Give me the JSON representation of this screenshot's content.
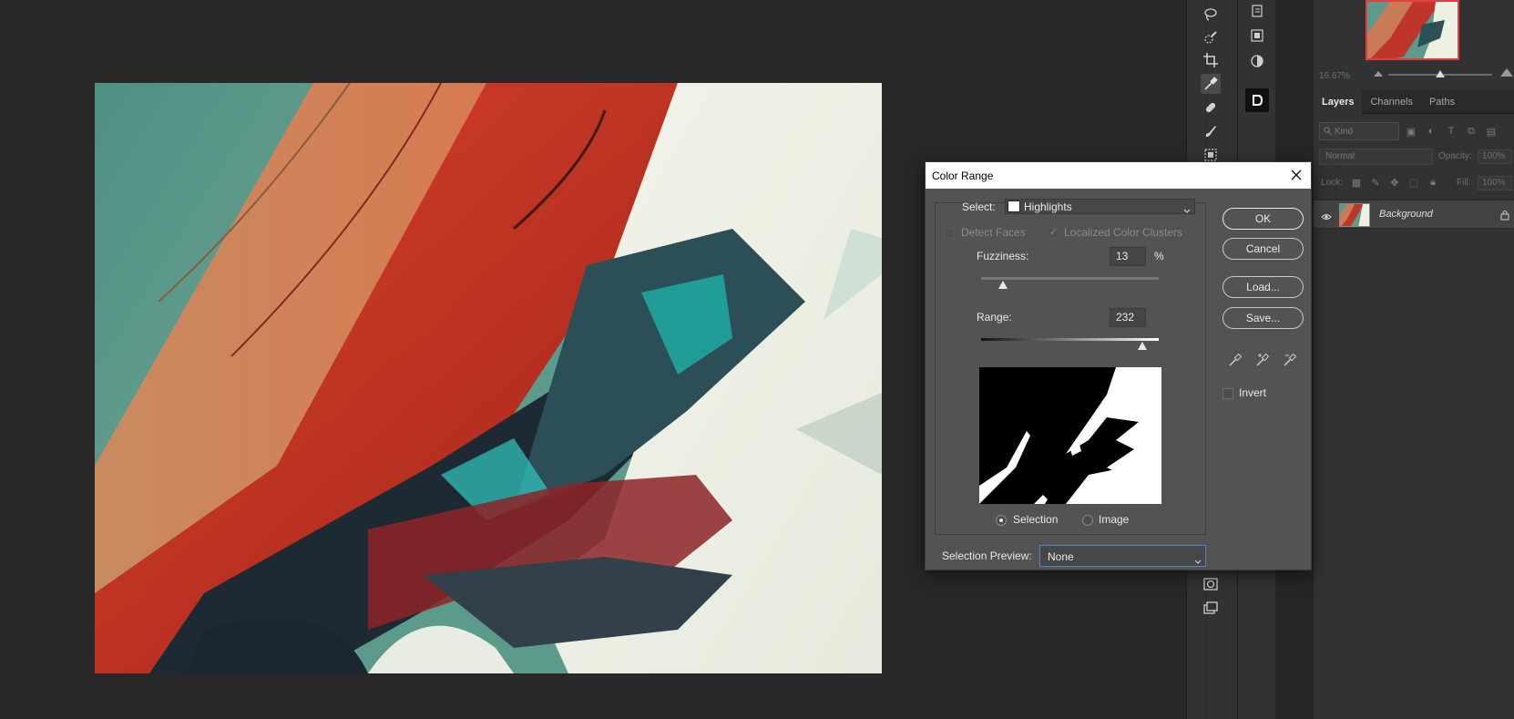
{
  "dialog": {
    "title": "Color Range",
    "select_label": "Select:",
    "select_value": "Highlights",
    "detect_faces_label": "Detect Faces",
    "localized_clusters_label": "Localized Color Clusters",
    "fuzziness_label": "Fuzziness:",
    "fuzziness_value": "13",
    "fuzziness_unit": "%",
    "fuzziness_level_pct": 13,
    "range_label": "Range:",
    "range_value": "232",
    "range_level_pct": 91,
    "view_selection_label": "Selection",
    "view_image_label": "Image",
    "selection_preview_label": "Selection Preview:",
    "selection_preview_value": "None",
    "buttons": {
      "ok": "OK",
      "cancel": "Cancel",
      "load": "Load...",
      "save": "Save..."
    },
    "invert_label": "Invert",
    "detect_faces_checked": false,
    "localized_clusters_checked": true,
    "invert_checked": false,
    "view_selected": "Selection"
  },
  "navigator": {
    "zoom": "16.67%",
    "zoom_level_pct": 47
  },
  "layers": {
    "tabs": [
      "Layers",
      "Channels",
      "Paths"
    ],
    "active_tab": "Layers",
    "filter_kind": "Kind",
    "blend_mode": "Normal",
    "opacity_label": "Opacity:",
    "opacity_value": "100%",
    "lock_label": "Lock:",
    "fill_label": "Fill:",
    "fill_value": "100%",
    "layer_name": "Background"
  },
  "colors": {
    "workspace": "#282828",
    "panel": "#323232",
    "dialog": "#535353",
    "selection_highlight": "#4a86d0",
    "navigator_frame": "#e04040"
  },
  "icons": {
    "tools": [
      "lasso-tool-icon",
      "quick-selection-tool-icon",
      "crop-tool-icon",
      "eyedropper-tool-icon",
      "spot-healing-brush-icon",
      "brush-tool-icon",
      "clone-stamp-icon",
      "quick-mask-icon",
      "screen-mode-icon"
    ],
    "eyedroppers": [
      "eyedropper-icon",
      "eyedropper-add-icon",
      "eyedropper-subtract-icon"
    ]
  }
}
